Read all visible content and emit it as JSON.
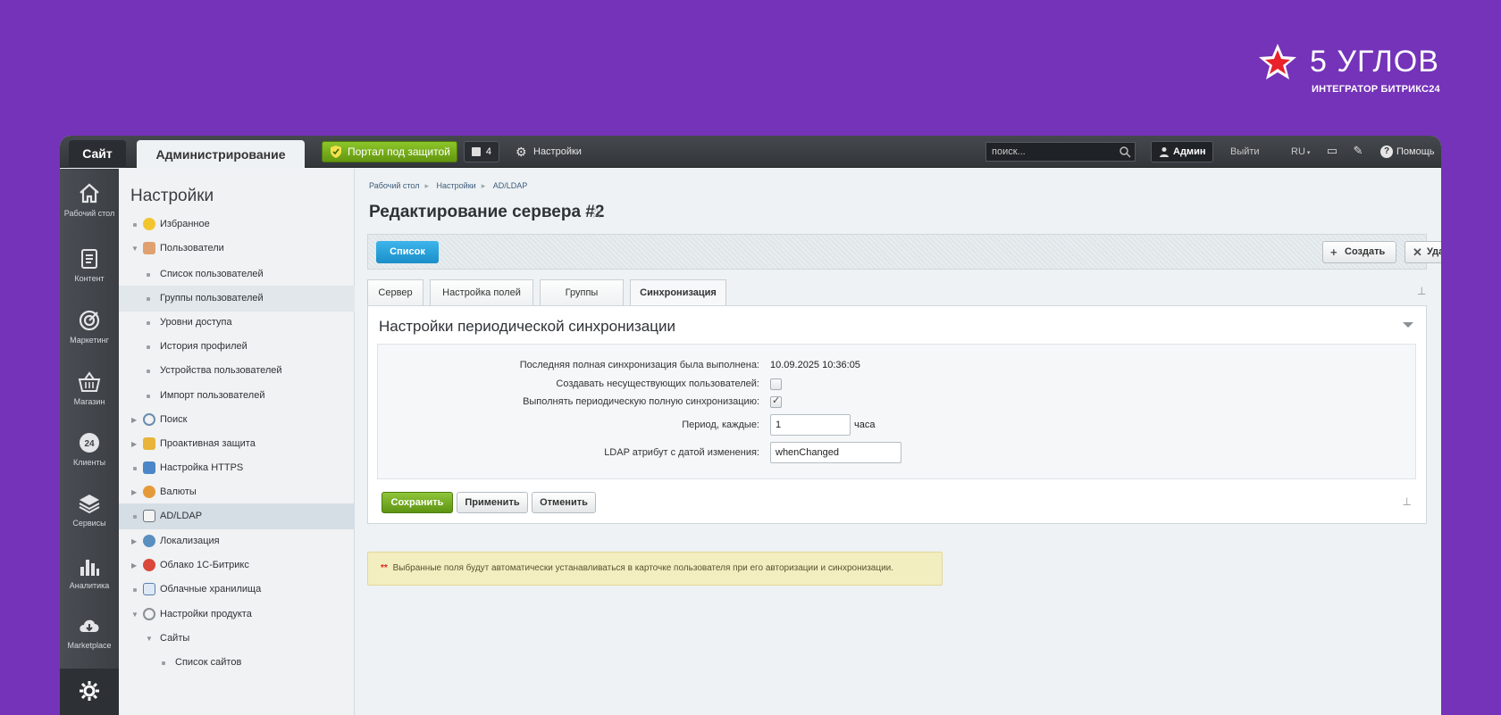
{
  "brand": {
    "title": "5 УГЛОВ",
    "subtitle": "ИНТЕГРАТОР БИТРИКС24",
    "accent": "#e8212b"
  },
  "topbar": {
    "tab_site": "Сайт",
    "tab_admin": "Администрирование",
    "protect_label": "Портал под защитой",
    "notif_count": "4",
    "settings_label": "Настройки",
    "search_placeholder": "поиск...",
    "admin_label": "Админ",
    "logout_label": "Выйти",
    "lang_label": "RU",
    "help_label": "Помощь"
  },
  "leftbar": {
    "items": [
      {
        "label": "Рабочий стол",
        "icon": "home-icon"
      },
      {
        "label": "Контент",
        "icon": "document-icon"
      },
      {
        "label": "Маркетинг",
        "icon": "target-icon"
      },
      {
        "label": "Магазин",
        "icon": "basket-icon"
      },
      {
        "label": "Клиенты",
        "icon": "clients-24-icon"
      },
      {
        "label": "Сервисы",
        "icon": "layers-icon"
      },
      {
        "label": "Аналитика",
        "icon": "chart-icon"
      },
      {
        "label": "Marketplace",
        "icon": "cloud-download-icon"
      },
      {
        "label": "",
        "icon": "gear-icon"
      }
    ]
  },
  "menu": {
    "title": "Настройки",
    "items": [
      {
        "label": "Избранное"
      },
      {
        "label": "Пользователи"
      },
      {
        "label": "Список пользователей"
      },
      {
        "label": "Группы пользователей"
      },
      {
        "label": "Уровни доступа"
      },
      {
        "label": "История профилей"
      },
      {
        "label": "Устройства пользователей"
      },
      {
        "label": "Импорт пользователей"
      },
      {
        "label": "Поиск"
      },
      {
        "label": "Проактивная защита"
      },
      {
        "label": "Настройка HTTPS"
      },
      {
        "label": "Валюты"
      },
      {
        "label": "AD/LDAP"
      },
      {
        "label": "Локализация"
      },
      {
        "label": "Облако 1С-Битрикс"
      },
      {
        "label": "Облачные хранилища"
      },
      {
        "label": "Настройки продукта"
      },
      {
        "label": "Сайты"
      },
      {
        "label": "Список сайтов"
      }
    ]
  },
  "breadcrumb": {
    "items": [
      "Рабочий стол",
      "Настройки",
      "AD/LDAP"
    ]
  },
  "page": {
    "title": "Редактирование сервера #2"
  },
  "toolbar": {
    "list_label": "Список",
    "create_label": "Создать",
    "delete_label": "Удалить"
  },
  "tabs": [
    "Сервер",
    "Настройка полей",
    "Группы",
    "Синхронизация"
  ],
  "panel": {
    "title": "Настройки периодической синхронизации",
    "fields": {
      "last_sync_label": "Последняя полная синхронизация была выполнена:",
      "last_sync_value": "10.09.2025 10:36:05",
      "create_missing_label": "Создавать несуществующих пользователей:",
      "create_missing_checked": false,
      "periodic_sync_label": "Выполнять периодическую полную синхронизацию:",
      "periodic_sync_checked": true,
      "period_label": "Период, каждые:",
      "period_value": "1",
      "period_unit": "часа",
      "ldap_attr_label": "LDAP атрибут с датой изменения:",
      "ldap_attr_value": "whenChanged"
    }
  },
  "buttons": {
    "save": "Сохранить",
    "apply": "Применить",
    "cancel": "Отменить"
  },
  "note": {
    "asterisk": "**",
    "text": "Выбранные поля будут автоматически устанавливаться в карточке пользователя при его авторизации и синхронизации."
  }
}
